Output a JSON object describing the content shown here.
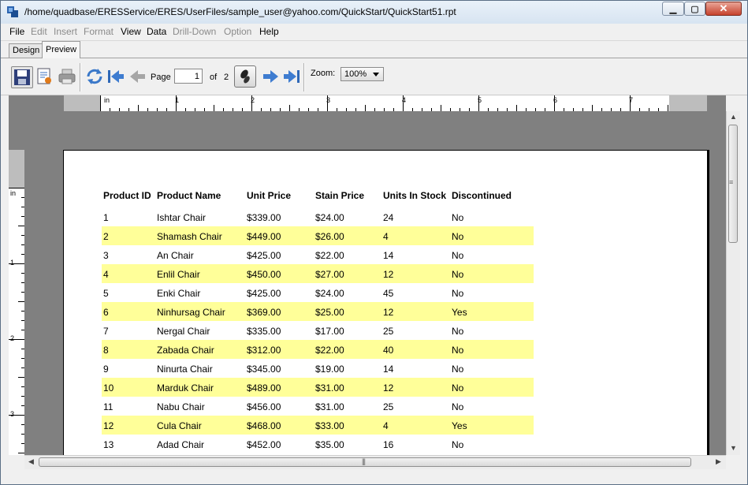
{
  "window": {
    "title": "/home/quadbase/ERESService/ERES/UserFiles/sample_user@yahoo.com/QuickStart/QuickStart51.rpt"
  },
  "menu": {
    "items": [
      {
        "label": "File",
        "enabled": true
      },
      {
        "label": "Edit",
        "enabled": false
      },
      {
        "label": "Insert",
        "enabled": false
      },
      {
        "label": "Format",
        "enabled": false
      },
      {
        "label": "View",
        "enabled": true
      },
      {
        "label": "Data",
        "enabled": true
      },
      {
        "label": "Drill-Down",
        "enabled": false
      },
      {
        "label": "Option",
        "enabled": false
      },
      {
        "label": "Help",
        "enabled": true
      }
    ]
  },
  "tabs": {
    "design": "Design",
    "preview": "Preview",
    "active": "Preview"
  },
  "toolbar": {
    "page_label": "Page",
    "page_value": "1",
    "of_label": "of",
    "page_total": "2",
    "zoom_label": "Zoom:",
    "zoom_value": "100%"
  },
  "ruler": {
    "unit": "in",
    "h_labels": [
      "1",
      "2",
      "3",
      "4",
      "5",
      "6",
      "7"
    ],
    "v_labels": [
      "1",
      "2",
      "3"
    ]
  },
  "report": {
    "highlight_color": "#ffff99",
    "columns": [
      "Product ID",
      "Product Name",
      "Unit Price",
      "Stain Price",
      "Units In Stock",
      "Discontinued"
    ],
    "rows": [
      [
        "1",
        "Ishtar Chair",
        "$339.00",
        "$24.00",
        "24",
        "No"
      ],
      [
        "2",
        "Shamash Chair",
        "$449.00",
        "$26.00",
        "4",
        "No"
      ],
      [
        "3",
        "An Chair",
        "$425.00",
        "$22.00",
        "14",
        "No"
      ],
      [
        "4",
        "Enlil Chair",
        "$450.00",
        "$27.00",
        "12",
        "No"
      ],
      [
        "5",
        "Enki Chair",
        "$425.00",
        "$24.00",
        "45",
        "No"
      ],
      [
        "6",
        "Ninhursag Chair",
        "$369.00",
        "$25.00",
        "12",
        "Yes"
      ],
      [
        "7",
        "Nergal Chair",
        "$335.00",
        "$17.00",
        "25",
        "No"
      ],
      [
        "8",
        "Zabada Chair",
        "$312.00",
        "$22.00",
        "40",
        "No"
      ],
      [
        "9",
        "Ninurta Chair",
        "$345.00",
        "$19.00",
        "14",
        "No"
      ],
      [
        "10",
        "Marduk Chair",
        "$489.00",
        "$31.00",
        "12",
        "No"
      ],
      [
        "11",
        "Nabu Chair",
        "$456.00",
        "$31.00",
        "25",
        "No"
      ],
      [
        "12",
        "Cula Chair",
        "$468.00",
        "$33.00",
        "4",
        "Yes"
      ],
      [
        "13",
        "Adad Chair",
        "$452.00",
        "$35.00",
        "16",
        "No"
      ]
    ]
  },
  "icons": {
    "app": "app-icon",
    "save": "save-icon",
    "export": "export-icon",
    "print": "print-icon",
    "refresh": "refresh-icon",
    "first": "first-page-icon",
    "prev": "prev-page-icon",
    "goto": "go-to-page-icon",
    "next": "next-page-icon",
    "last": "last-page-icon"
  }
}
